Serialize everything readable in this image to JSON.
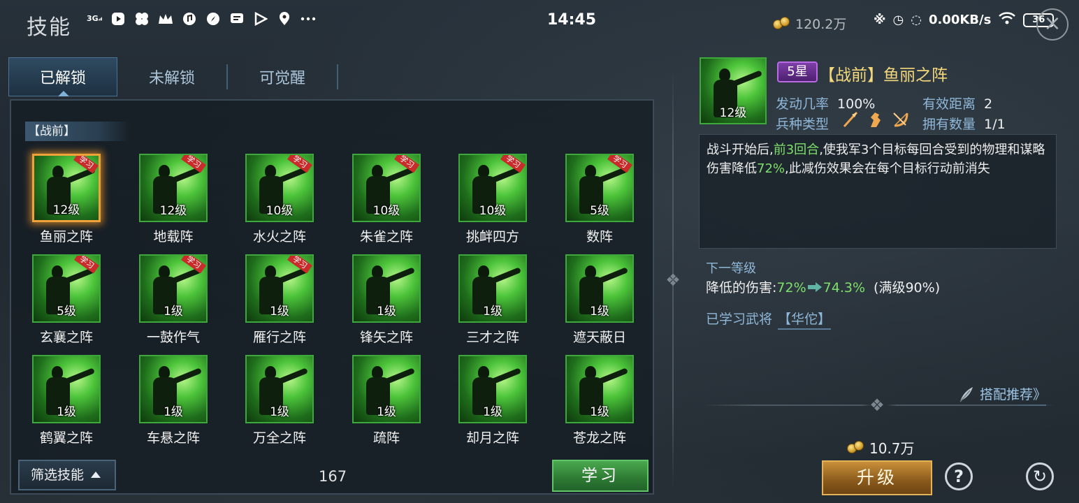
{
  "header": {
    "title": "技能"
  },
  "status_bar": {
    "network": "3G",
    "time": "14:45",
    "speed": "0.00KB/s",
    "battery": "36",
    "icons": [
      "signal-icon",
      "media-icon",
      "pinwheel-icon",
      "crown-icon",
      "music-icon",
      "compass-icon",
      "chat-icon",
      "play-icon",
      "location-icon",
      "more-icon"
    ]
  },
  "currency": {
    "amount": "120.2万"
  },
  "tabs": [
    {
      "label": "已解锁",
      "active": true
    },
    {
      "label": "未解锁",
      "active": false
    },
    {
      "label": "可觉醒",
      "active": false
    }
  ],
  "section": {
    "label": "【战前】"
  },
  "skills": [
    {
      "name": "鱼丽之阵",
      "level": "12级",
      "learn_badge": "学习",
      "selected": true
    },
    {
      "name": "地载阵",
      "level": "12级",
      "learn_badge": "学习"
    },
    {
      "name": "水火之阵",
      "level": "10级",
      "learn_badge": "学习"
    },
    {
      "name": "朱雀之阵",
      "level": "10级",
      "learn_badge": "学习"
    },
    {
      "name": "挑衅四方",
      "level": "10级",
      "learn_badge": "学习"
    },
    {
      "name": "数阵",
      "level": "5级",
      "learn_badge": "学习"
    },
    {
      "name": "玄襄之阵",
      "level": "5级",
      "learn_badge": "学习"
    },
    {
      "name": "一鼓作气",
      "level": "1级",
      "learn_badge": "学习"
    },
    {
      "name": "雁行之阵",
      "level": "1级",
      "learn_badge": "学习"
    },
    {
      "name": "锋矢之阵",
      "level": "1级"
    },
    {
      "name": "三才之阵",
      "level": "1级"
    },
    {
      "name": "遮天蔽日",
      "level": "1级"
    },
    {
      "name": "鹤翼之阵",
      "level": "1级"
    },
    {
      "name": "车悬之阵",
      "level": "1级"
    },
    {
      "name": "万全之阵",
      "level": "1级"
    },
    {
      "name": "疏阵",
      "level": "1级"
    },
    {
      "name": "却月之阵",
      "level": "1级"
    },
    {
      "name": "苍龙之阵",
      "level": "1级"
    }
  ],
  "footer": {
    "filter_label": "筛选技能",
    "count": "167",
    "learn_label": "学习"
  },
  "detail": {
    "level": "12级",
    "star": "5星",
    "title": "【战前】鱼丽之阵",
    "trigger_label": "发动几率",
    "trigger_value": "100%",
    "range_label": "有效距离",
    "range_value": "2",
    "troop_label": "兵种类型",
    "troop_icons": [
      "spear-icon",
      "horse-icon",
      "bow-icon"
    ],
    "owned_label": "拥有数量",
    "owned_value": "1/1",
    "desc_pre": "战斗开始后,",
    "desc_hl1": "前3回合",
    "desc_mid": ",使我军3个目标每回合受到的物理和谋略伤害降低",
    "desc_hl2": "72%",
    "desc_post": ",此减伤效果会在每个目标行动前消失",
    "next_title": "下一等级",
    "next_label": "降低的伤害:",
    "next_from": "72%",
    "next_to": "74.3%",
    "next_max": "(满级90%)",
    "learned_label": "已学习武将",
    "learned_value": "【华佗】",
    "recommend_label": "搭配推荐》",
    "cost": "10.7万",
    "upgrade_label": "升级",
    "help_label": "?"
  },
  "colors": {
    "accent_green": "#7ee06a",
    "title_gold": "#f5d87c",
    "label_blue": "#8fb7d8",
    "star_purple": "#7d3fa8",
    "learn_badge_red": "#c92a2a"
  }
}
